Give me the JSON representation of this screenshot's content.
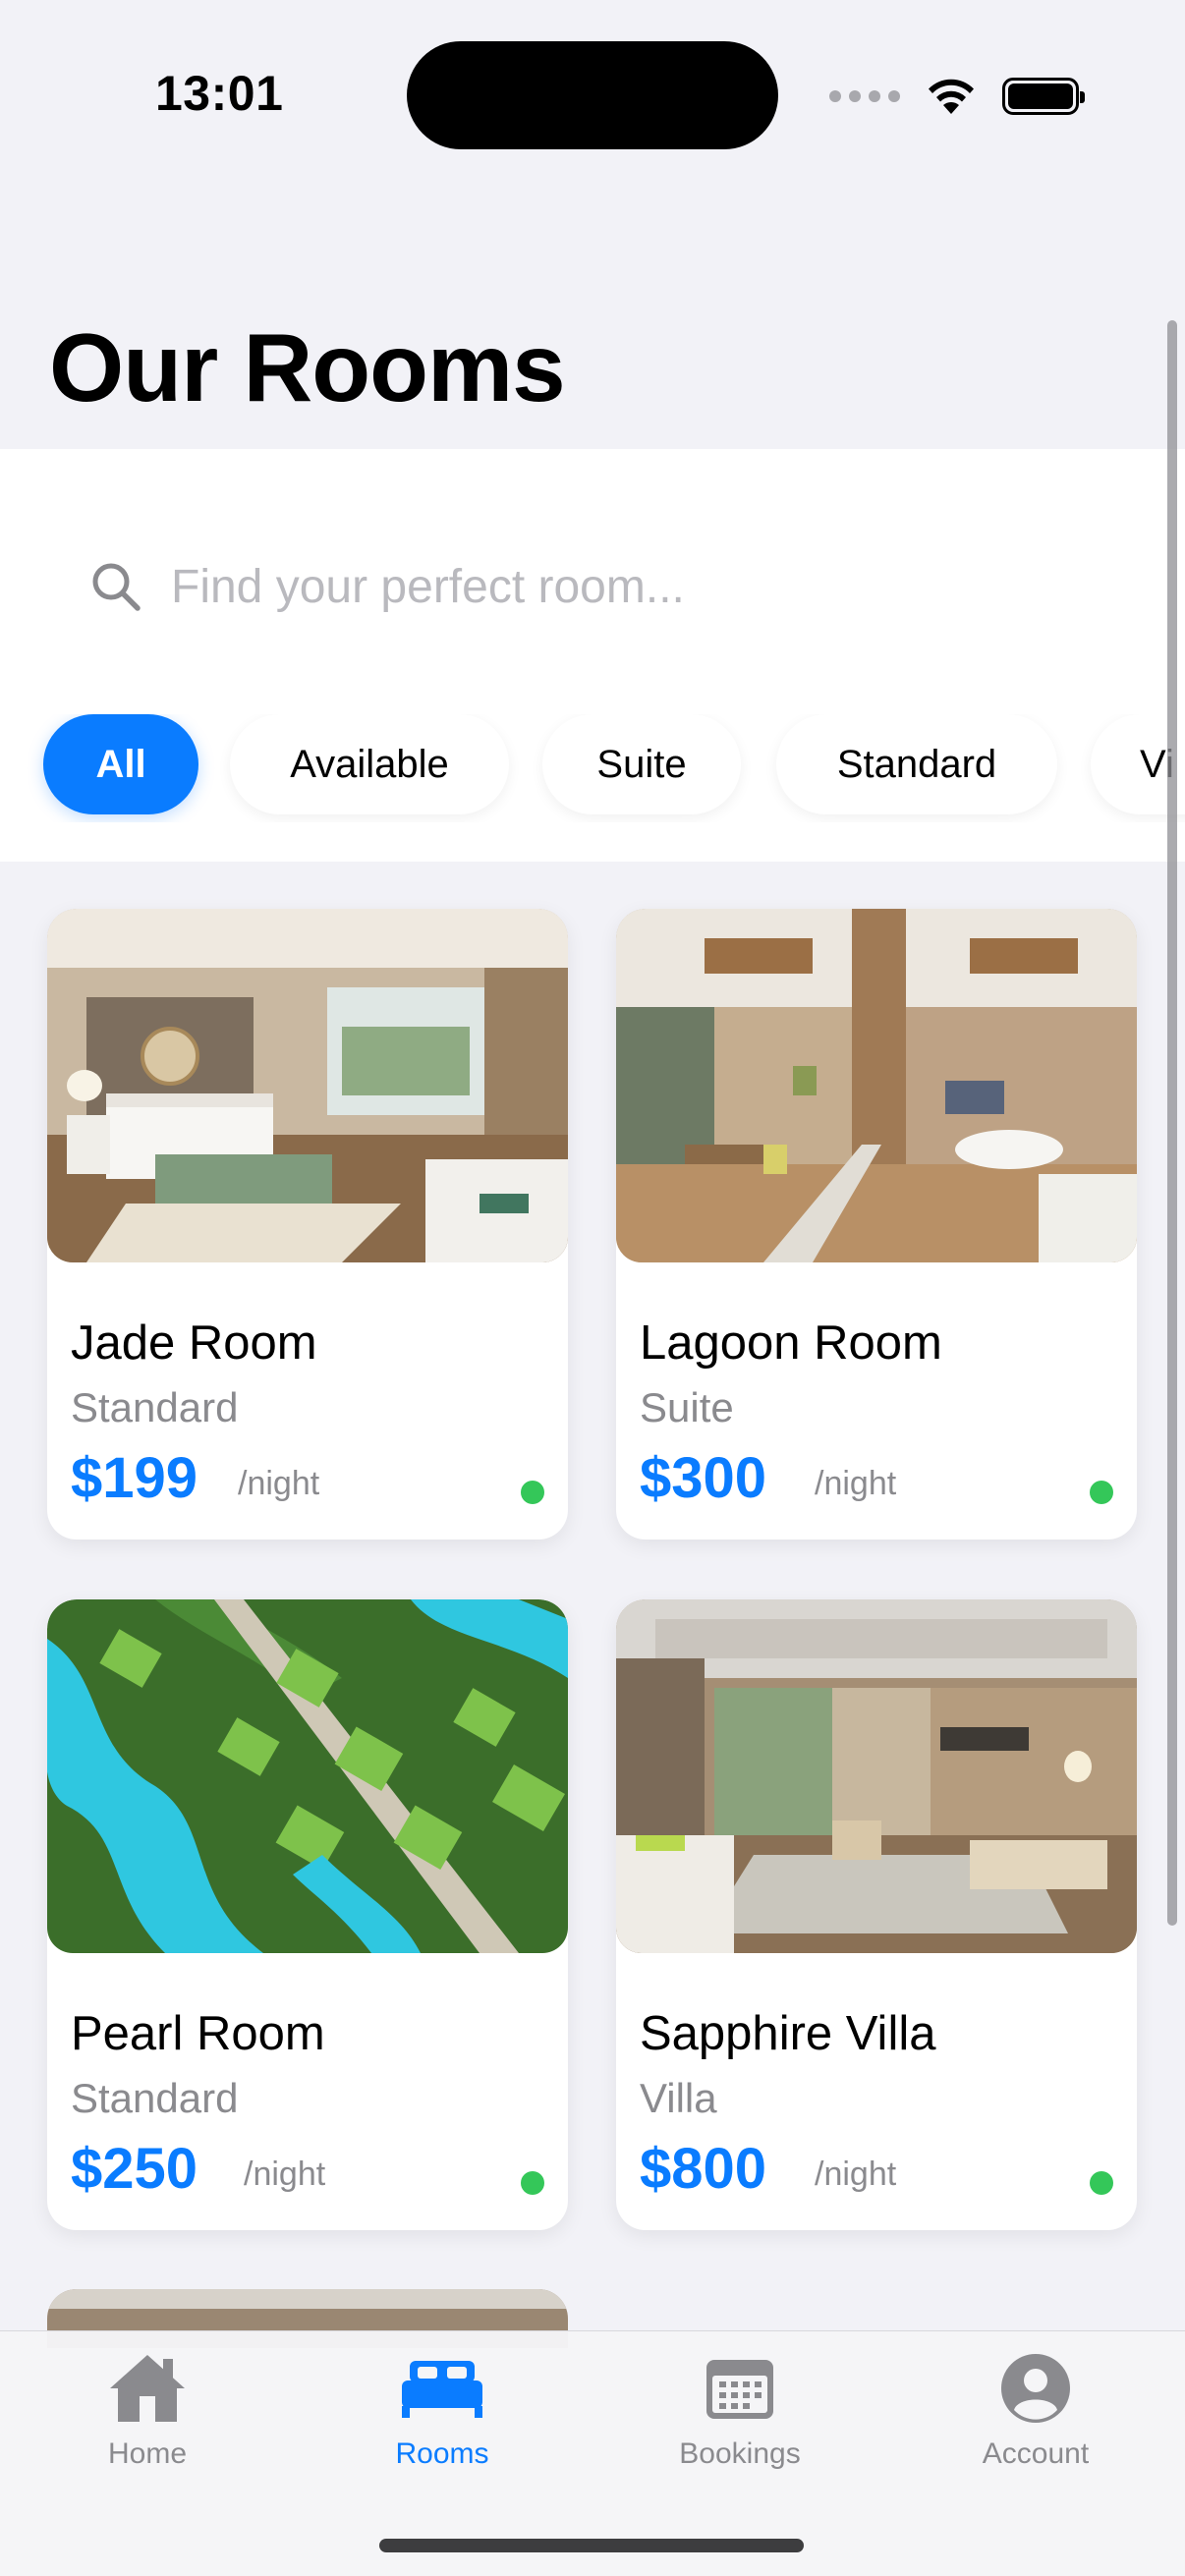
{
  "status_bar": {
    "time": "13:01",
    "icons": [
      "signal-dots-icon",
      "wifi-icon",
      "battery-icon"
    ]
  },
  "page": {
    "title": "Our Rooms"
  },
  "search": {
    "placeholder": "Find your perfect room...",
    "value": "",
    "icon": "search-icon"
  },
  "filters": {
    "chips": [
      {
        "label": "All",
        "active": true
      },
      {
        "label": "Available",
        "active": false
      },
      {
        "label": "Suite",
        "active": false
      },
      {
        "label": "Standard",
        "active": false
      },
      {
        "label": "Vi",
        "active": false
      }
    ]
  },
  "rooms": [
    {
      "name": "Jade Room",
      "type": "Standard",
      "price": "$199",
      "per": "/night",
      "available": true,
      "image": "hotel-bedroom-photo"
    },
    {
      "name": "Lagoon Room",
      "type": "Suite",
      "price": "$300",
      "per": "/night",
      "available": true,
      "image": "suite-living-room-photo"
    },
    {
      "name": "Pearl Room",
      "type": "Standard",
      "price": "$250",
      "per": "/night",
      "available": true,
      "image": "aerial-lagoon-villas-photo"
    },
    {
      "name": "Sapphire Villa",
      "type": "Villa",
      "price": "$800",
      "per": "/night",
      "available": true,
      "image": "villa-lounge-photo"
    }
  ],
  "tab_bar": {
    "tabs": [
      {
        "label": "Home",
        "icon": "house-icon",
        "active": false
      },
      {
        "label": "Rooms",
        "icon": "bed-icon",
        "active": true
      },
      {
        "label": "Bookings",
        "icon": "calendar-icon",
        "active": false
      },
      {
        "label": "Account",
        "icon": "person-circle-icon",
        "active": false
      }
    ]
  },
  "colors": {
    "accent": "#0a7cff",
    "available": "#34c759",
    "secondary_text": "#8a8a8e",
    "background": "#f2f2f7"
  }
}
